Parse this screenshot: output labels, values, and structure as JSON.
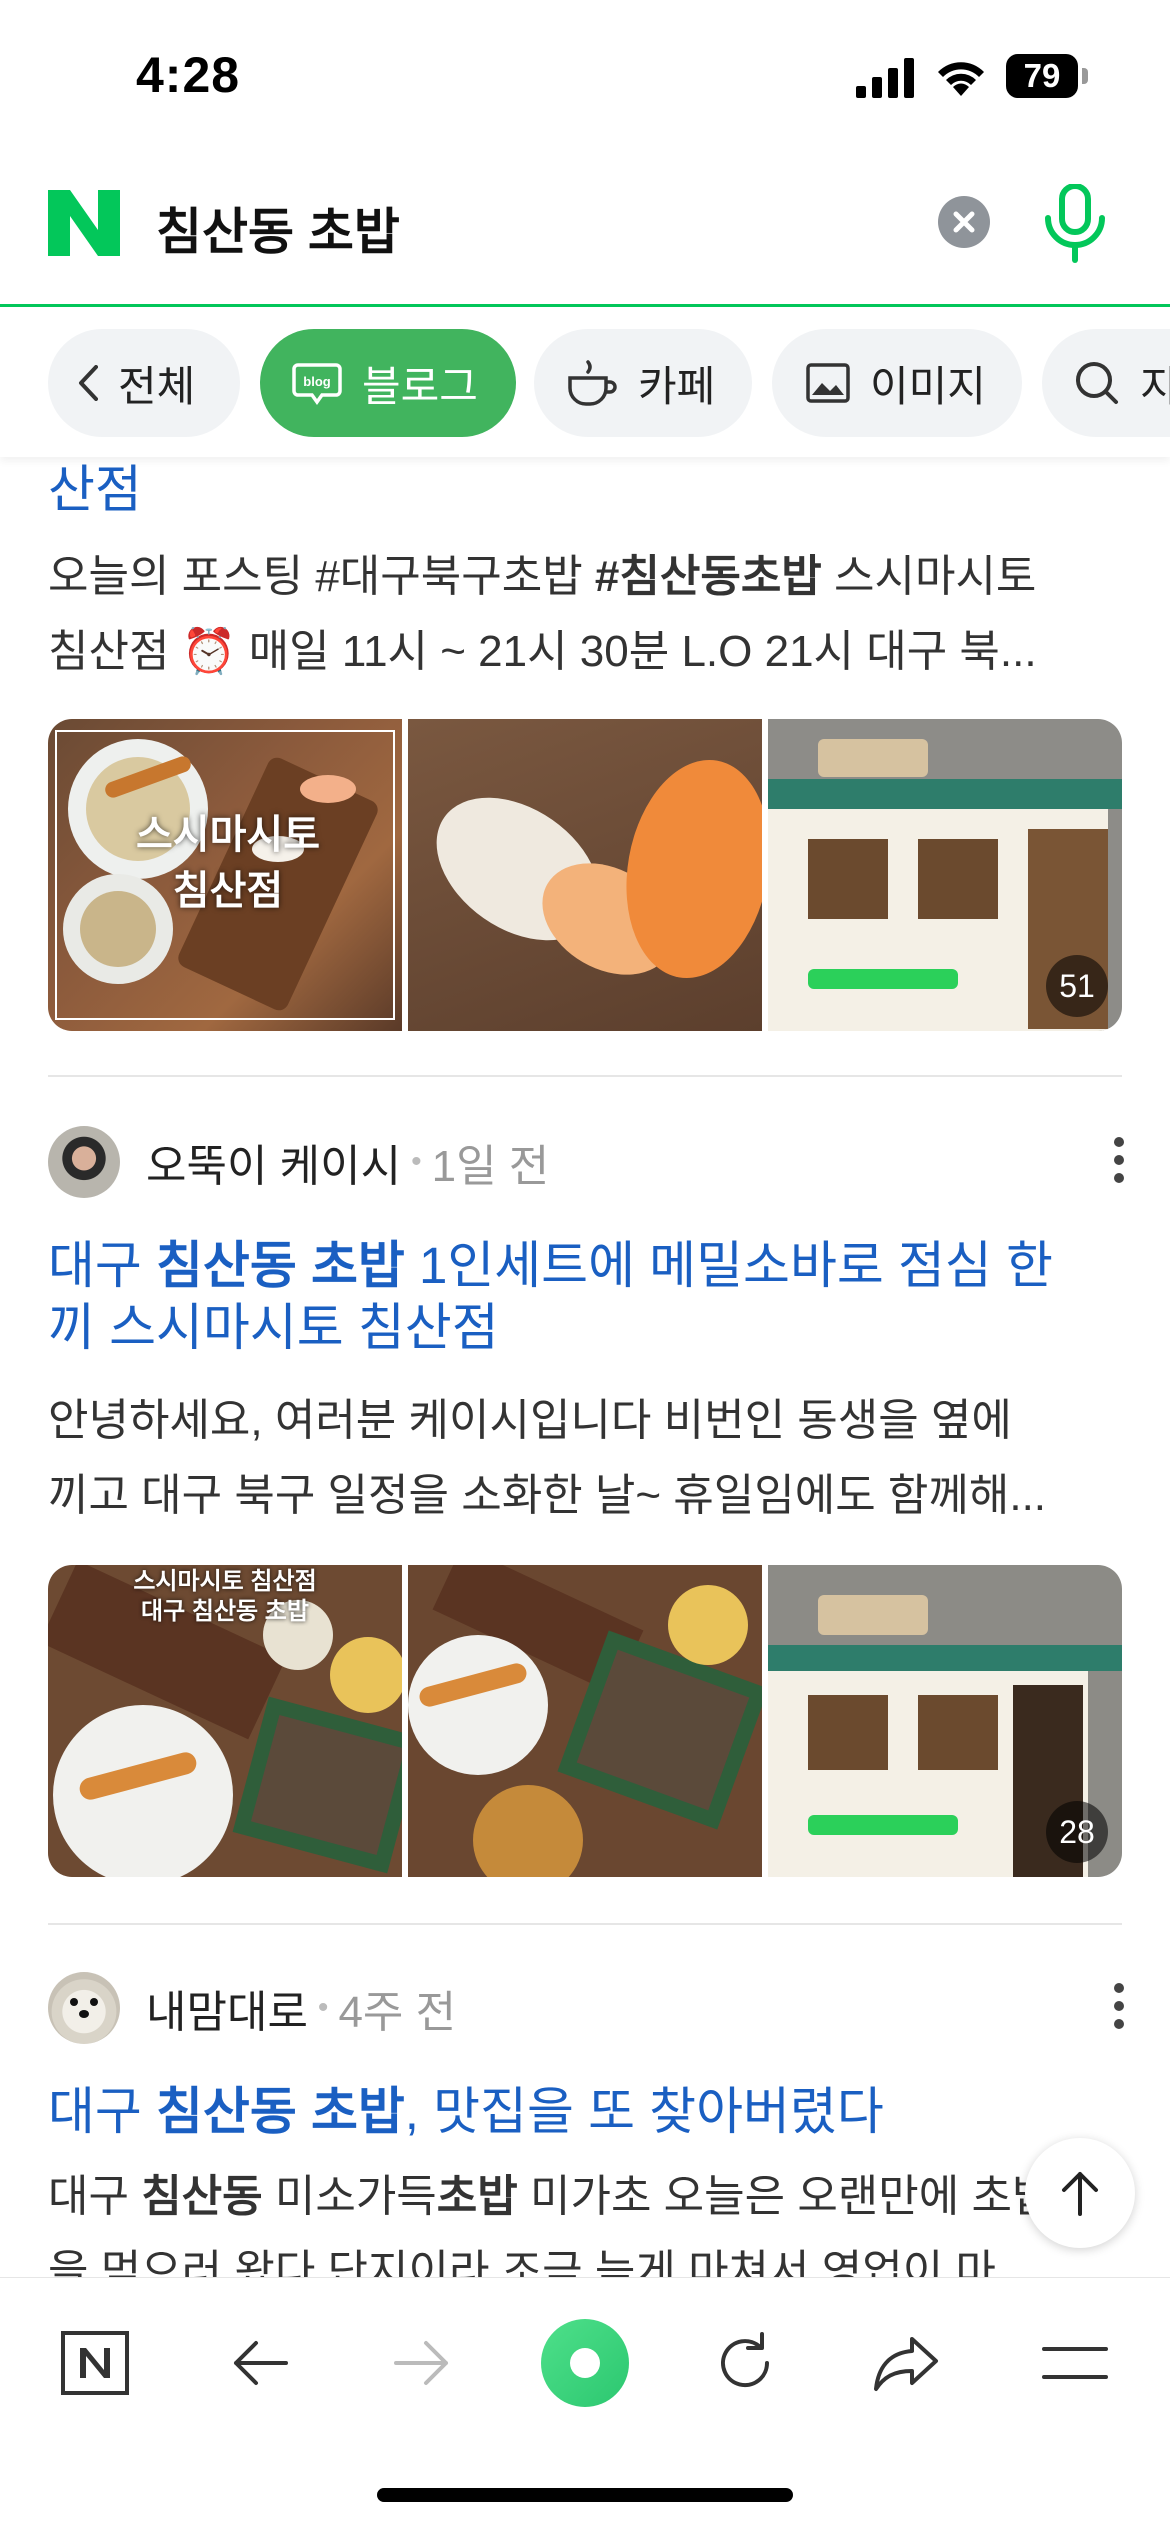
{
  "status_bar": {
    "time": "4:28",
    "battery": "79"
  },
  "search": {
    "query": "침산동 초밥"
  },
  "tabs": [
    {
      "label": "전체",
      "icon": "chevron-left-icon"
    },
    {
      "label": "블로그",
      "icon": "blog-icon",
      "active": true
    },
    {
      "label": "카페",
      "icon": "cafe-cup-icon"
    },
    {
      "label": "이미지",
      "icon": "image-icon"
    },
    {
      "label": "지",
      "icon": "search-icon"
    }
  ],
  "results": [
    {
      "title_tail": "산점",
      "desc_line1_parts": [
        "오늘의 포스팅 #대구북구초밥 ",
        "#침산동초밥",
        " 스시마시토"
      ],
      "desc_line2": "침산점 ⏰ 매일 11시 ~ 21시 30분 L.O 21시 대구 북...",
      "thumb_overlay_text": [
        "스시마시토",
        "침산점"
      ],
      "photo_count": "51"
    },
    {
      "author": "오뚝이 케이시",
      "time_ago": "1일 전",
      "title_parts": [
        "대구 ",
        "침산동 초밥",
        " 1인세트에 메밀소바로 점심 한"
      ],
      "title_line2": "끼 스시마시토 침산점",
      "desc_line1": "안녕하세요, 여러분 케이시입니다 비번인 동생을 옆에",
      "desc_line2": "끼고 대구 북구 일정을 소화한 날~ 휴일임에도 함께해...",
      "thumb_overlay_text": [
        "스시마시토 침산점",
        "대구 침산동 초밥"
      ],
      "photo_count": "28"
    },
    {
      "author": "내맘대로",
      "time_ago": "4주 전",
      "title_parts": [
        "대구 ",
        "침산동 초밥",
        ", 맛집을 또 찾아버렸다"
      ],
      "desc_line1_parts": [
        "대구 ",
        "침산동",
        " 미소가득",
        "초밥",
        " 미가초 오늘은 오랜만에 초밥"
      ],
      "desc_line2": "을 먹으러 왔다 단지이라 조금 늦게 마쳐서 영업이 마"
    }
  ],
  "colors": {
    "naver_green": "#03c75a",
    "tab_active": "#41b45e",
    "link_blue": "#1a5fc2"
  }
}
